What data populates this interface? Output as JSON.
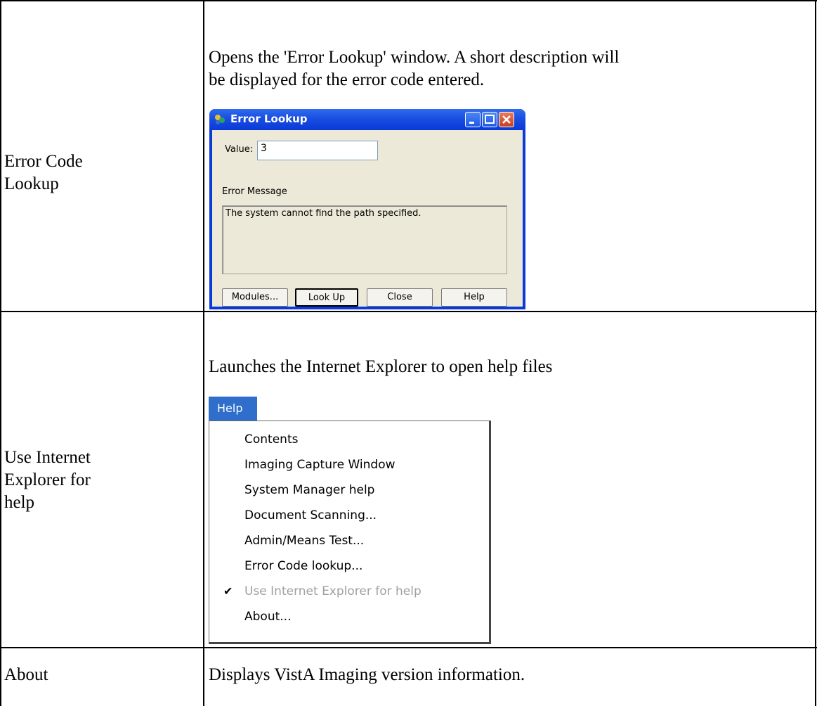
{
  "rows": [
    {
      "feature": "Error Code\nLookup",
      "description": "Opens the 'Error Lookup' window. A short description will\nbe displayed for the error code entered."
    },
    {
      "feature": "Use Internet\nExplorer for\nhelp",
      "description": "Launches the Internet Explorer to open help files"
    },
    {
      "feature": "About",
      "description": "Displays VistA Imaging version information."
    }
  ],
  "error_lookup_dialog": {
    "title": "Error Lookup",
    "value_label": "Value:",
    "value": "3",
    "error_message_label": "Error Message",
    "error_message": "The system cannot find the path specified.",
    "buttons": {
      "modules": "Modules...",
      "look_up": "Look Up",
      "close": "Close",
      "help": "Help"
    }
  },
  "help_menu": {
    "title": "Help",
    "items": [
      {
        "label": "Contents"
      },
      {
        "label": "Imaging Capture Window"
      },
      {
        "label": "System Manager help"
      },
      {
        "label": "Document Scanning..."
      },
      {
        "label": "Admin/Means Test..."
      },
      {
        "label": "Error Code lookup..."
      },
      {
        "label": "Use Internet Explorer for help",
        "checked": true,
        "disabled": true
      },
      {
        "label": "About..."
      }
    ]
  }
}
